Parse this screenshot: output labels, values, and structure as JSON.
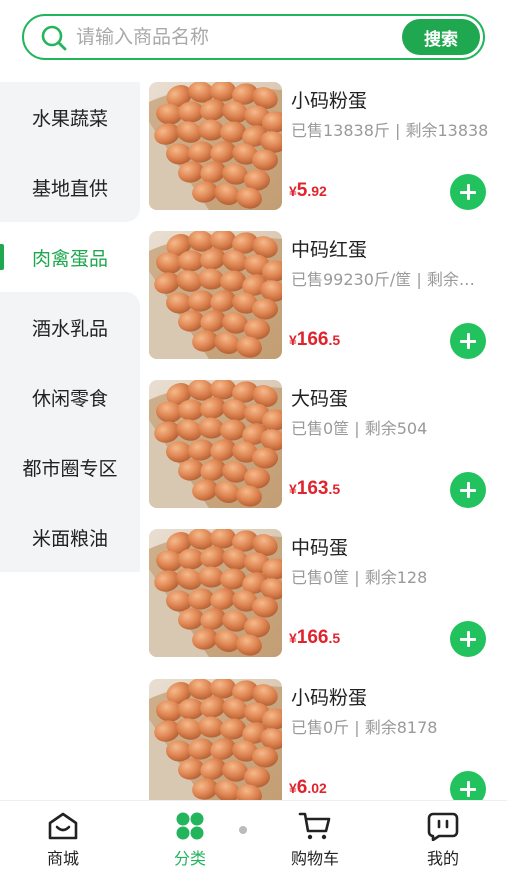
{
  "search": {
    "placeholder": "请输入商品名称",
    "button_label": "搜索"
  },
  "sidebar": {
    "items": [
      {
        "label": "水果蔬菜",
        "active": false
      },
      {
        "label": "基地直供",
        "active": false
      },
      {
        "label": "肉禽蛋品",
        "active": true
      },
      {
        "label": "酒水乳品",
        "active": false
      },
      {
        "label": "休闲零食",
        "active": false
      },
      {
        "label": "都市圈专区",
        "active": false
      },
      {
        "label": "米面粮油",
        "active": false
      }
    ]
  },
  "products": [
    {
      "name": "小码粉蛋",
      "stats": "已售13838斤 | 剩余13838",
      "price_symbol": "¥",
      "price_int": "5",
      "price_dec": ".92"
    },
    {
      "name": "中码红蛋",
      "stats": "已售99230斤/筐 | 剩余…",
      "price_symbol": "¥",
      "price_int": "166",
      "price_dec": ".5"
    },
    {
      "name": "大码蛋",
      "stats": "已售0筐 | 剩余504",
      "price_symbol": "¥",
      "price_int": "163",
      "price_dec": ".5"
    },
    {
      "name": "中码蛋",
      "stats": "已售0筐 | 剩余128",
      "price_symbol": "¥",
      "price_int": "166",
      "price_dec": ".5"
    },
    {
      "name": "小码粉蛋",
      "stats": "已售0斤 | 剩余8178",
      "price_symbol": "¥",
      "price_int": "6",
      "price_dec": ".02"
    }
  ],
  "tabbar": {
    "items": [
      {
        "label": "商城",
        "icon": "home-icon",
        "active": false
      },
      {
        "label": "分类",
        "icon": "category-icon",
        "active": true
      },
      {
        "label": "购物车",
        "icon": "cart-icon",
        "active": false
      },
      {
        "label": "我的",
        "icon": "profile-icon",
        "active": false
      }
    ]
  },
  "colors": {
    "accent": "#22b55c",
    "price": "#e0242e",
    "sidebar_bg": "#f3f4f5"
  }
}
